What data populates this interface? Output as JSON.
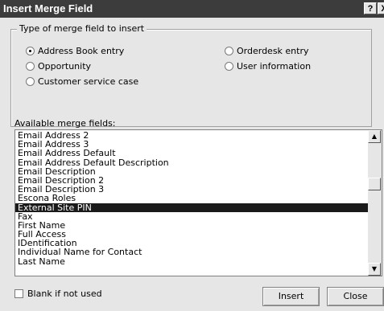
{
  "window": {
    "title": "Insert Merge Field",
    "help_label": "?",
    "close_label": "X"
  },
  "merge_type": {
    "group_label": "Type of merge field to insert",
    "options": [
      {
        "label": "Address Book entry",
        "selected": true
      },
      {
        "label": "Opportunity",
        "selected": false
      },
      {
        "label": "Customer service case",
        "selected": false
      },
      {
        "label": "Orderdesk entry",
        "selected": false
      },
      {
        "label": "User information",
        "selected": false
      }
    ]
  },
  "fields": {
    "label": "Available merge fields:",
    "items": [
      "Email Address 2",
      "Email Address 3",
      "Email Address Default",
      "Email Address Default Description",
      "Email Description",
      "Email Description 2",
      "Email Description 3",
      "Escona Roles",
      "External Site PIN",
      "Fax",
      "First Name",
      "Full Access",
      "IDentification",
      "Individual Name for Contact",
      "Last Name"
    ],
    "selected_item": "External Site PIN"
  },
  "blank_if_not_used": {
    "label": "Blank if not used",
    "checked": false
  },
  "buttons": {
    "insert": "Insert",
    "close": "Close"
  },
  "icons": {
    "scroll_up": "▲",
    "scroll_down": "▼"
  }
}
